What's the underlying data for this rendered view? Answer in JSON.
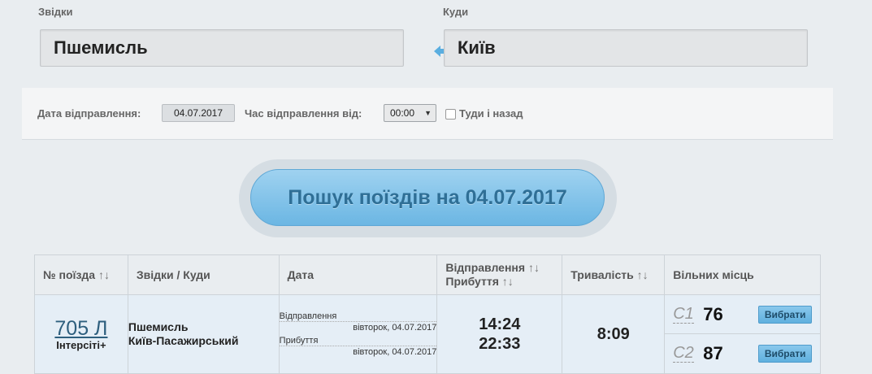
{
  "route": {
    "from_label": "Звідки",
    "to_label": "Куди",
    "from_value": "Пшемисль",
    "to_value": "Київ"
  },
  "filters": {
    "date_label": "Дата відправлення:",
    "date_value": "04.07.2017",
    "time_label": "Час відправлення від:",
    "time_value": "00:00",
    "roundtrip_label": "Туди і назад",
    "roundtrip_checked": false
  },
  "search": {
    "button_label": "Пошук поїздів на 04.07.2017"
  },
  "table": {
    "headers": {
      "train": "№ поїзда",
      "route": "Звідки / Куди",
      "date": "Дата",
      "departure": "Відправлення",
      "arrival": "Прибуття",
      "duration": "Тривалість",
      "seats": "Вільних місць"
    },
    "sort_glyph": "↑↓",
    "rows": [
      {
        "number": "705 Л",
        "type": "Інтерсіті+",
        "from": "Пшемисль",
        "to": "Київ-Пасажирський",
        "dep_label": "Відправлення",
        "dep_date": "вівторок, 04.07.2017",
        "arr_label": "Прибуття",
        "arr_date": "вівторок, 04.07.2017",
        "dep_time": "14:24",
        "arr_time": "22:33",
        "duration": "8:09",
        "seats": [
          {
            "class": "С1",
            "count": "76",
            "button": "Вибрати"
          },
          {
            "class": "С2",
            "count": "87",
            "button": "Вибрати"
          }
        ]
      }
    ]
  }
}
